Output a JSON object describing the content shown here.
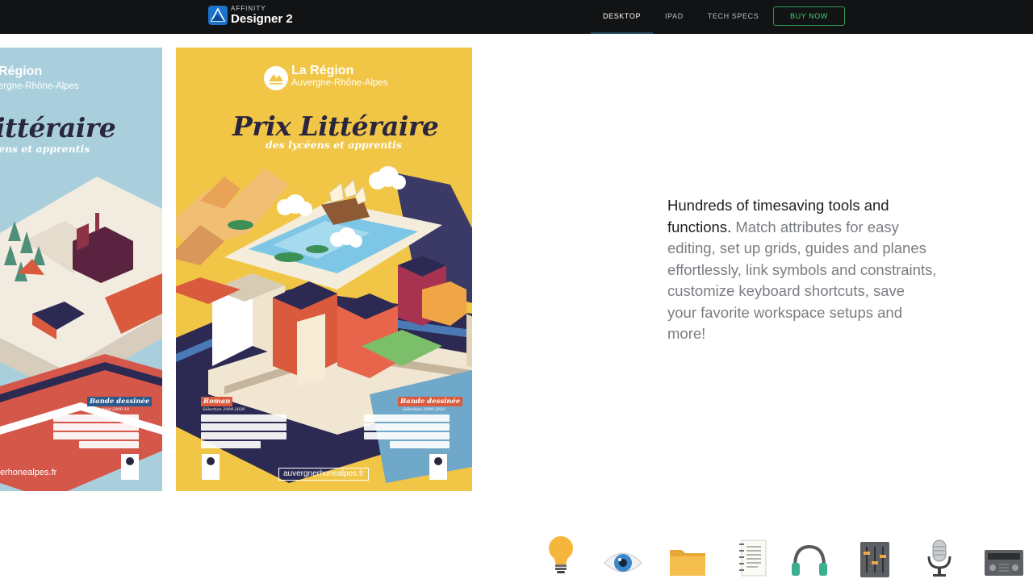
{
  "nav": {
    "brand_small": "AFFINITY",
    "brand_big": "Designer 2",
    "links": [
      "DESKTOP",
      "IPAD",
      "TECH SPECS"
    ],
    "active_link": "DESKTOP",
    "buy_label": "BUY NOW"
  },
  "posters": {
    "left": {
      "region_name": "Région",
      "region_sub": "ergne-Rhône-Alpes",
      "title": "ittéraire",
      "subtitle": "ens et apprentis",
      "tag": "Bande dessinée",
      "tag_sub": "Sélection 2000-10",
      "url": "erhonealpes.fr"
    },
    "right": {
      "region_name": "La Région",
      "region_sub": "Auvergne-Rhône-Alpes",
      "title": "Prix Littéraire",
      "subtitle": "des lycéens et apprentis",
      "tag_roman": "Roman",
      "tag_roman_sub": "Sélection 2009-2020",
      "tag_bd": "Bande dessinée",
      "tag_bd_sub": "Sélection 2009-2020",
      "url": "auvergnerhonealpes.fr"
    }
  },
  "copy": {
    "strong": "Hundreds of timesaving tools and functions.",
    "body": " Match attributes for easy editing, set up grids, guides and planes effortlessly, link symbols and constraints, customize keyboard shortcuts, save your favorite workspace setups and more!"
  },
  "icons": [
    "lightbulb-icon",
    "eye-icon",
    "folder-icon",
    "notepad-icon",
    "headphones-icon",
    "mixer-icon",
    "microphone-icon",
    "radio-icon"
  ],
  "colors": {
    "nav_bg": "#121314",
    "buy_accent": "#3fcf6a",
    "poster_blue": "#a9cfdc",
    "poster_yellow": "#f1c545",
    "title_dark": "#2b2640"
  }
}
